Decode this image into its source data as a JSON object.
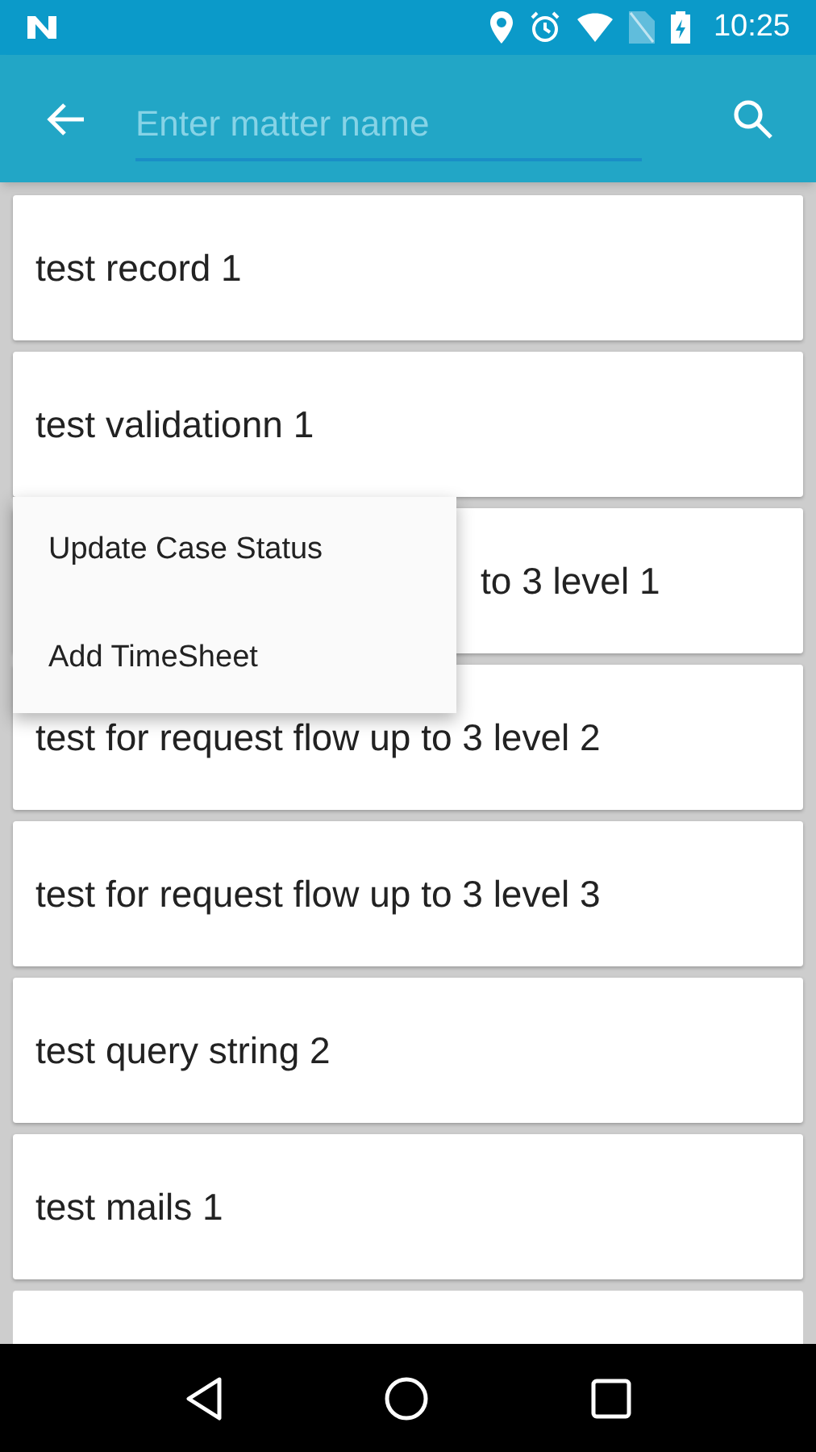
{
  "status_bar": {
    "time": "10:25"
  },
  "toolbar": {
    "search": {
      "placeholder": "Enter matter name"
    }
  },
  "matters": [
    {
      "name": "test record 1",
      "covered": false
    },
    {
      "name": "test validationn 1",
      "covered": false
    },
    {
      "name": "to 3 level 1",
      "covered": true
    },
    {
      "name": "test for request flow up to 3 level 2",
      "covered": false
    },
    {
      "name": "test for request flow up to 3 level 3",
      "covered": false
    },
    {
      "name": "test query string 2",
      "covered": false
    },
    {
      "name": "test mails 1",
      "covered": false
    }
  ],
  "context_menu": {
    "items": [
      "Update Case Status",
      "Add TimeSheet"
    ]
  }
}
